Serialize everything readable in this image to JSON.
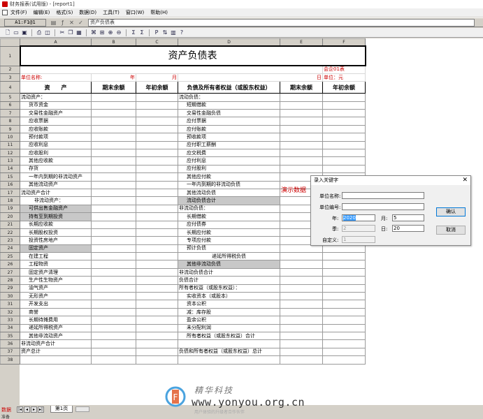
{
  "window": {
    "title": "财务报表(试用版) - [report1]"
  },
  "menu": {
    "items": [
      "文件(F)",
      "编辑(E)",
      "格式(S)",
      "数据(D)",
      "工具(T)",
      "窗口(W)",
      "帮助(H)"
    ]
  },
  "formula_bar": {
    "cell_ref": "A1:F1@1",
    "content": "资产负债表"
  },
  "toolbar": {
    "icons": [
      "new-file-icon",
      "open-folder-icon",
      "save-icon",
      "print-icon",
      "print-preview-icon",
      "cut-icon",
      "copy-icon",
      "paste-icon",
      "format-painter-icon",
      "merge-cells-icon",
      "insert-row-icon",
      "delete-row-icon",
      "sum-icon",
      "insert-function-icon",
      "param-icon",
      "sort-icon",
      "chart-icon",
      "help-icon"
    ]
  },
  "sheet": {
    "columns": [
      "A",
      "B",
      "C",
      "D",
      "E",
      "F"
    ],
    "title": "资产负债表",
    "form_code": "会企01表",
    "unit_label": "单位名称:",
    "year_label": "年",
    "month_label": "月",
    "day_label": "日",
    "currency_label": "单位：元",
    "headers": {
      "asset": "资　　产",
      "period_end": "期末余额",
      "year_begin": "年初余额",
      "liability": "负债及所有者权益（或股东权益）",
      "period_end2": "期末余额",
      "year_begin2": "年初余额"
    },
    "row_numbers": [
      "1",
      "2",
      "3",
      "4",
      "5",
      "6",
      "7",
      "8",
      "9",
      "10",
      "11",
      "12",
      "13",
      "14",
      "15",
      "16",
      "17",
      "18",
      "19",
      "20",
      "21",
      "22",
      "23",
      "24",
      "25",
      "26",
      "27",
      "28",
      "29",
      "30",
      "31",
      "32",
      "33",
      "34",
      "35",
      "36",
      "37",
      "38"
    ],
    "body_rows": [
      {
        "a": "流动资产：",
        "d": "流动负债："
      },
      {
        "a": "货币资金",
        "d": "短期借款"
      },
      {
        "a": "交易性金融资产",
        "d": "交易性金融负债"
      },
      {
        "a": "应收票据",
        "d": "应付票据"
      },
      {
        "a": "应收账款",
        "d": "应付账款"
      },
      {
        "a": "预付款项",
        "d": "预收款项"
      },
      {
        "a": "应收利息",
        "d": "应付职工薪酬"
      },
      {
        "a": "应收股利",
        "d": "应交税费"
      },
      {
        "a": "其他应收款",
        "d": "应付利息"
      },
      {
        "a": "存货",
        "d": "应付股利"
      },
      {
        "a": "一年内到期的非流动资产",
        "d": "其他应付款"
      },
      {
        "a": "其他流动资产",
        "d": "一年内到期的非流动负债"
      },
      {
        "a": "流动资产合计",
        "d": "其他流动负债"
      },
      {
        "a": "非流动资产：",
        "d": "流动负债合计"
      },
      {
        "a": "可供出售金融资产",
        "d": "非流动负债："
      },
      {
        "a": "持有至到期投资",
        "d": "长期借款"
      },
      {
        "a": "长期应收款",
        "d": "应付债券"
      },
      {
        "a": "长期股权投资",
        "d": "长期应付款"
      },
      {
        "a": "投资性房地产",
        "d": "专项应付款"
      },
      {
        "a": "固定资产",
        "d": "预计负债"
      },
      {
        "a": "在建工程",
        "d": "递延所得税负债"
      },
      {
        "a": "工程物资",
        "d": "其他非流动负债"
      },
      {
        "a": "固定资产清理",
        "d": "非流动负债合计"
      },
      {
        "a": "生产性生物资产",
        "d": "负债合计"
      },
      {
        "a": "油气资产",
        "d": "所有者权益（或股东权益）："
      },
      {
        "a": "无形资产",
        "d": "实收资本（或股本）"
      },
      {
        "a": "开发支出",
        "d": "资本公积"
      },
      {
        "a": "商誉",
        "d": "减：库存股"
      },
      {
        "a": "长期待摊费用",
        "d": "盈余公积"
      },
      {
        "a": "递延所得税资产",
        "d": "未分配利润"
      },
      {
        "a": "其他非流动资产",
        "d": "所有者权益（或股东权益）合计"
      },
      {
        "a": "非流动资产合计",
        "d": ""
      },
      {
        "a": "资产总计",
        "d": "负债和所有者权益（或股东权益）总计"
      }
    ]
  },
  "demo_text": "演示数据",
  "dialog": {
    "title": "录入关键字",
    "close": "✕",
    "unit_name_label": "单位名称:",
    "unit_code_label": "单位编号:",
    "year_label": "年:",
    "year_value": "2020",
    "month_label": "月:",
    "month_value": "5",
    "quarter_label": "季:",
    "quarter_value": "2",
    "day_label": "日:",
    "day_value": "20",
    "custom_label": "自定义:",
    "custom_value": "1",
    "ok_label": "确认",
    "cancel_label": "取消"
  },
  "bottom": {
    "mode": "数据",
    "tab": "第1页",
    "status": "准备"
  },
  "watermark": {
    "brand": "精华科技",
    "url": "www.yonyou.org.cn",
    "sub": "用户体验的升级者合作伙伴"
  },
  "colors": {
    "accent_red": "#cc0000",
    "dialog_focus": "#0078d7",
    "selection": "#3399ff"
  }
}
